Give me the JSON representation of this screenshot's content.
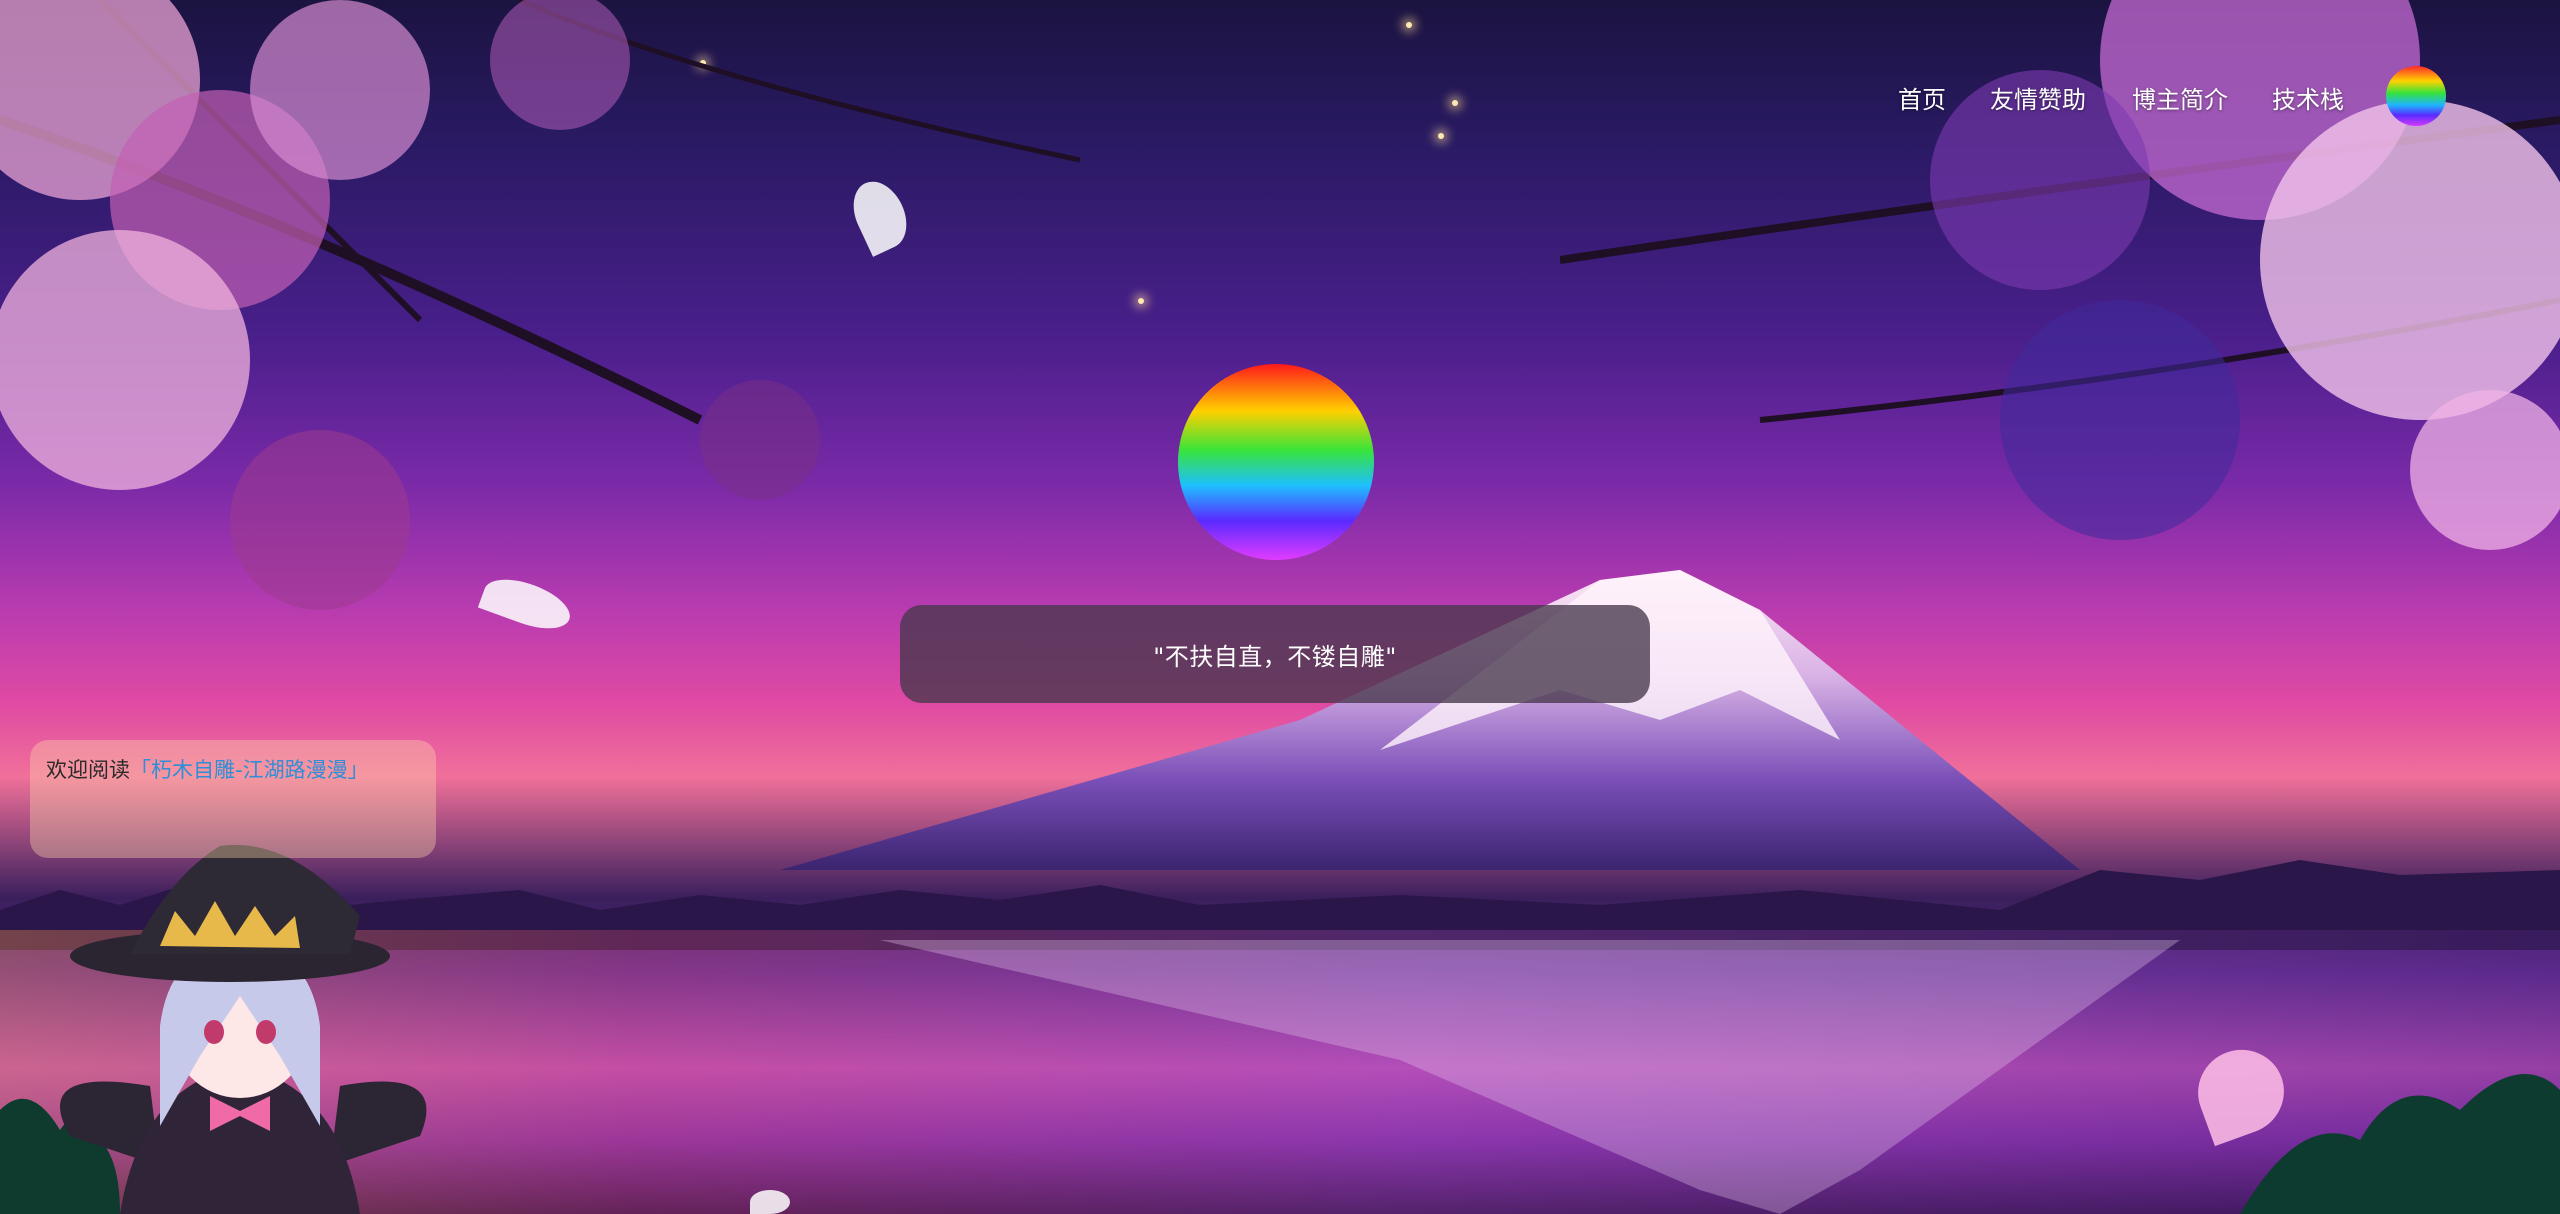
{
  "nav": {
    "items": [
      {
        "label": "首页"
      },
      {
        "label": "友情赞助"
      },
      {
        "label": "博主简介"
      },
      {
        "label": "技术栈"
      }
    ],
    "avatar_icon": "rainbow-avatar-icon"
  },
  "hero": {
    "avatar_icon": "rainbow-avatar-icon",
    "motto": "\"不扶自直，不镂自雕\""
  },
  "welcome": {
    "prefix": "欢迎阅读",
    "link_text": "「朽木自雕-江湖路漫漫」"
  },
  "colors": {
    "link": "#2e8fd8",
    "motto_bg": "#46374b",
    "welcome_bg": "#ffd6aa"
  },
  "background": {
    "scene": "cherry-blossom-mount-fuji-night",
    "mascot": "witch-girl-mascot"
  }
}
